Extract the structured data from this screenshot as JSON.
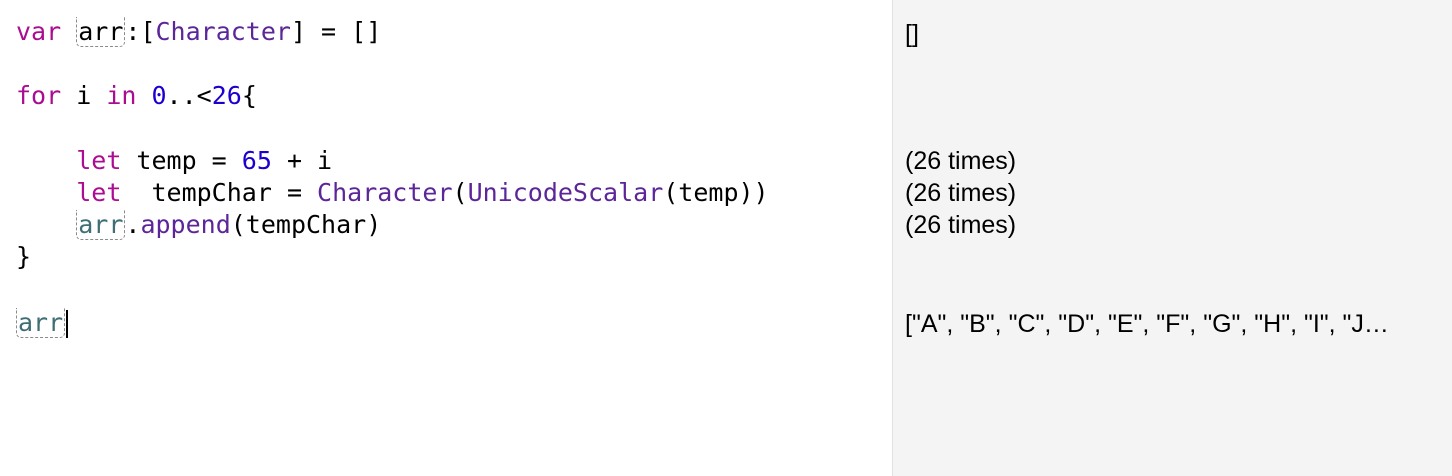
{
  "editor": {
    "lines": [
      {
        "tokens": [
          {
            "text": "var",
            "kind": "kw"
          },
          {
            "text": " "
          },
          {
            "text": "arr",
            "kind": "plain",
            "outlined": true
          },
          {
            "text": ":["
          },
          {
            "text": "Character",
            "kind": "type"
          },
          {
            "text": "] = []"
          }
        ]
      },
      {
        "tokens": [
          {
            "text": "for",
            "kind": "kw"
          },
          {
            "text": " i "
          },
          {
            "text": "in",
            "kind": "kw"
          },
          {
            "text": " "
          },
          {
            "text": "0",
            "kind": "num"
          },
          {
            "text": "..<"
          },
          {
            "text": "26",
            "kind": "num"
          },
          {
            "text": "{"
          }
        ]
      },
      {
        "tokens": [
          {
            "text": "    "
          },
          {
            "text": "let",
            "kind": "kw"
          },
          {
            "text": " temp = "
          },
          {
            "text": "65",
            "kind": "num"
          },
          {
            "text": " + i"
          }
        ]
      },
      {
        "tokens": [
          {
            "text": "    "
          },
          {
            "text": "let",
            "kind": "kw"
          },
          {
            "text": "  tempChar = "
          },
          {
            "text": "Character",
            "kind": "type"
          },
          {
            "text": "("
          },
          {
            "text": "UnicodeScalar",
            "kind": "type"
          },
          {
            "text": "(temp))"
          }
        ]
      },
      {
        "tokens": [
          {
            "text": "    "
          },
          {
            "text": "arr",
            "kind": "var",
            "outlined": true
          },
          {
            "text": "."
          },
          {
            "text": "append",
            "kind": "type"
          },
          {
            "text": "(tempChar)"
          }
        ]
      },
      {
        "tokens": [
          {
            "text": "}"
          }
        ]
      },
      {
        "tokens": [
          {
            "text": "arr",
            "kind": "var",
            "outlined": true
          }
        ],
        "caret": true
      }
    ]
  },
  "results": {
    "lines": [
      {
        "text": "[]",
        "style": "normal"
      },
      {
        "text": "(26 times)",
        "style": "normal"
      },
      {
        "text": "(26 times)",
        "style": "normal"
      },
      {
        "text": "(26 times)",
        "style": "normal"
      },
      {
        "text": "[\"A\", \"B\", \"C\", \"D\", \"E\", \"F\", \"G\", \"H\", \"I\", \"J…",
        "style": "dim"
      }
    ]
  }
}
